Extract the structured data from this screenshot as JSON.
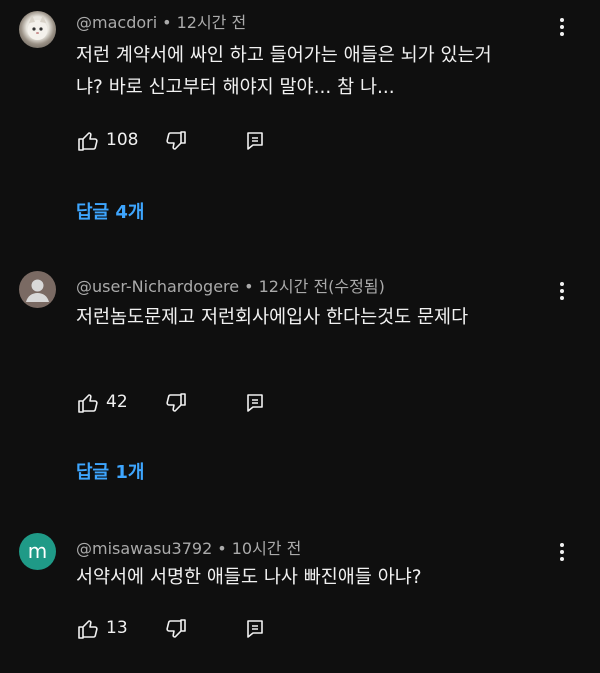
{
  "comments": [
    {
      "author": "@macdori",
      "separator": "•",
      "time": "12시간 전",
      "text": "저런 계약서에 싸인 하고 들어가는 애들은 뇌가 있는거냐? 바로 신고부터 해야지 말야... 참 나...",
      "likes": "108",
      "replies_label": "답글 4개",
      "avatar_icon": "cat-photo-avatar"
    },
    {
      "author": "@user-Nichardogere",
      "separator": "•",
      "time": "12시간 전(수정됨)",
      "text": "저런놈도문제고 저런회사에입사 한다는것도 문제다",
      "likes": "42",
      "replies_label": "답글 1개",
      "avatar_icon": "default-user-avatar"
    },
    {
      "author": "@misawasu3792",
      "separator": "•",
      "time": "10시간 전",
      "text": "서약서에 서명한 애들도 나사 빠진애들 아냐?",
      "likes": "13",
      "avatar_letter": "m"
    }
  ],
  "colors": {
    "background": "#0f0f0f",
    "text": "#f1f1f1",
    "meta": "#aaaaaa",
    "link": "#3ea6ff",
    "avatar_m": "#1f9a87"
  }
}
